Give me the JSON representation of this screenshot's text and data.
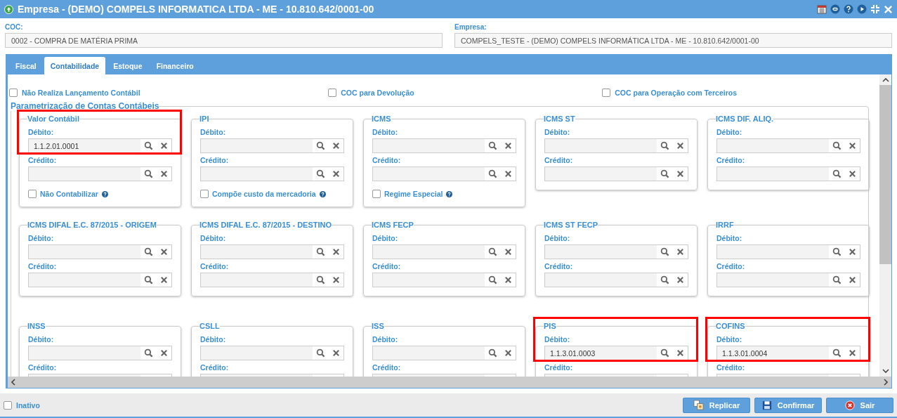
{
  "window": {
    "title": "Empresa - (DEMO) COMPELS INFORMATICA LTDA - ME - 10.810.642/0001-00"
  },
  "fields": [
    {
      "label": "COC:",
      "value": "0002 - COMPRA DE MATÉRIA PRIMA"
    },
    {
      "label": "Empresa:",
      "value": "COMPELS_TESTE - (DEMO) COMPELS INFORMÁTICA LTDA - ME - 10.810.642/0001-00"
    }
  ],
  "tabs": [
    {
      "label": "Fiscal",
      "selected": false
    },
    {
      "label": "Contabilidade",
      "selected": true
    },
    {
      "label": "Estoque",
      "selected": false
    },
    {
      "label": "Financeiro",
      "selected": false
    }
  ],
  "options": [
    {
      "label": "Não Realiza Lançamento Contábil",
      "checked": false
    },
    {
      "label": "COC para Devolução",
      "checked": false
    },
    {
      "label": "COC para Operação com Terceiros",
      "checked": false
    }
  ],
  "group": {
    "title": "Parametrização de Contas Contábeis",
    "cards": [
      {
        "title": "Valor Contábil",
        "highlighted": true,
        "fields": [
          {
            "label": "Débito:",
            "value": "1.1.2.01.0001"
          },
          {
            "label": "Crédito:"
          }
        ],
        "option": {
          "label": "Não Contabilizar",
          "checked": false
        }
      },
      {
        "title": "IPI",
        "highlighted": false,
        "fields": [
          {
            "label": "Débito:"
          },
          {
            "label": "Crédito:"
          }
        ],
        "option": {
          "label": "Compõe custo da mercadoria",
          "checked": false
        }
      },
      {
        "title": "ICMS",
        "highlighted": false,
        "fields": [
          {
            "label": "Débito:"
          },
          {
            "label": "Crédito:"
          }
        ],
        "option": {
          "label": "Regime Especial",
          "checked": false
        }
      },
      {
        "title": "ICMS ST",
        "highlighted": false,
        "fields": [
          {
            "label": "Débito:"
          },
          {
            "label": "Crédito:"
          }
        ]
      },
      {
        "title": "ICMS DIF. ALIQ.",
        "highlighted": false,
        "fields": [
          {
            "label": "Débito:"
          },
          {
            "label": "Crédito:"
          }
        ]
      },
      {
        "title": "ICMS DIFAL E.C. 87/2015 - ORIGEM",
        "highlighted": false,
        "fields": [
          {
            "label": "Débito:"
          },
          {
            "label": "Crédito:"
          }
        ]
      },
      {
        "title": "ICMS DIFAL E.C. 87/2015 - DESTINO",
        "highlighted": false,
        "fields": [
          {
            "label": "Débito:"
          },
          {
            "label": "Crédito:"
          }
        ]
      },
      {
        "title": "ICMS FECP",
        "highlighted": false,
        "fields": [
          {
            "label": "Débito:"
          },
          {
            "label": "Crédito:"
          }
        ]
      },
      {
        "title": "ICMS ST FECP",
        "highlighted": false,
        "fields": [
          {
            "label": "Débito:"
          },
          {
            "label": "Crédito:"
          }
        ]
      },
      {
        "title": "IRRF",
        "highlighted": false,
        "fields": [
          {
            "label": "Débito:"
          },
          {
            "label": "Crédito:"
          }
        ]
      },
      {
        "title": "INSS",
        "highlighted": false,
        "fields": [
          {
            "label": "Débito:"
          },
          {
            "label": "Crédito:"
          }
        ]
      },
      {
        "title": "CSLL",
        "highlighted": false,
        "fields": [
          {
            "label": "Débito:"
          },
          {
            "label": "Crédito:"
          }
        ]
      },
      {
        "title": "ISS",
        "highlighted": false,
        "fields": [
          {
            "label": "Débito:"
          },
          {
            "label": "Crédito:"
          }
        ]
      },
      {
        "title": "PIS",
        "highlighted": true,
        "fields": [
          {
            "label": "Débito:",
            "value": "1.1.3.01.0003"
          },
          {
            "label": "Crédito:"
          }
        ]
      },
      {
        "title": "COFINS",
        "highlighted": true,
        "fields": [
          {
            "label": "Débito:",
            "value": "1.1.3.01.0004"
          },
          {
            "label": "Crédito:"
          }
        ]
      }
    ]
  },
  "inactive": {
    "label": "Inativo",
    "checked": false
  },
  "buttons": [
    {
      "label": "Replicar",
      "kind": "replicate"
    },
    {
      "label": "Confirmar",
      "kind": "save"
    },
    {
      "label": "Sair",
      "kind": "exit"
    }
  ]
}
